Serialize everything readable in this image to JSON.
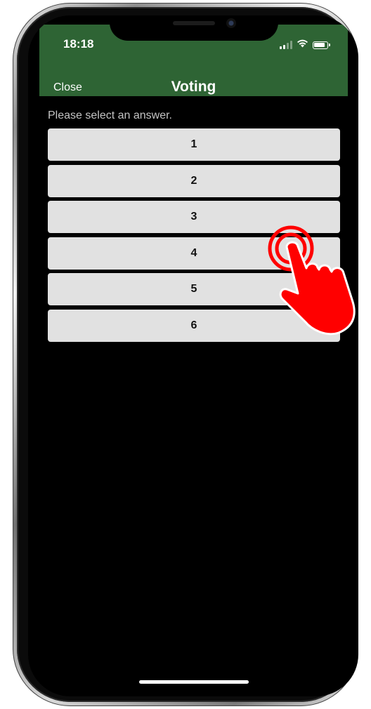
{
  "status_bar": {
    "time": "18:18",
    "icons": [
      "signal-icon",
      "wifi-icon",
      "battery-icon"
    ]
  },
  "nav": {
    "close_label": "Close",
    "title": "Voting"
  },
  "prompt": "Please select an answer.",
  "answers": [
    {
      "label": "1"
    },
    {
      "label": "2"
    },
    {
      "label": "3"
    },
    {
      "label": "4"
    },
    {
      "label": "5"
    },
    {
      "label": "6"
    }
  ],
  "colors": {
    "header_green": "#2e6434",
    "screen_background": "#000000",
    "button_background": "#e1e1e1",
    "tap_hand": "#ff0000"
  },
  "overlay": {
    "icon": "tap-hand-icon"
  }
}
